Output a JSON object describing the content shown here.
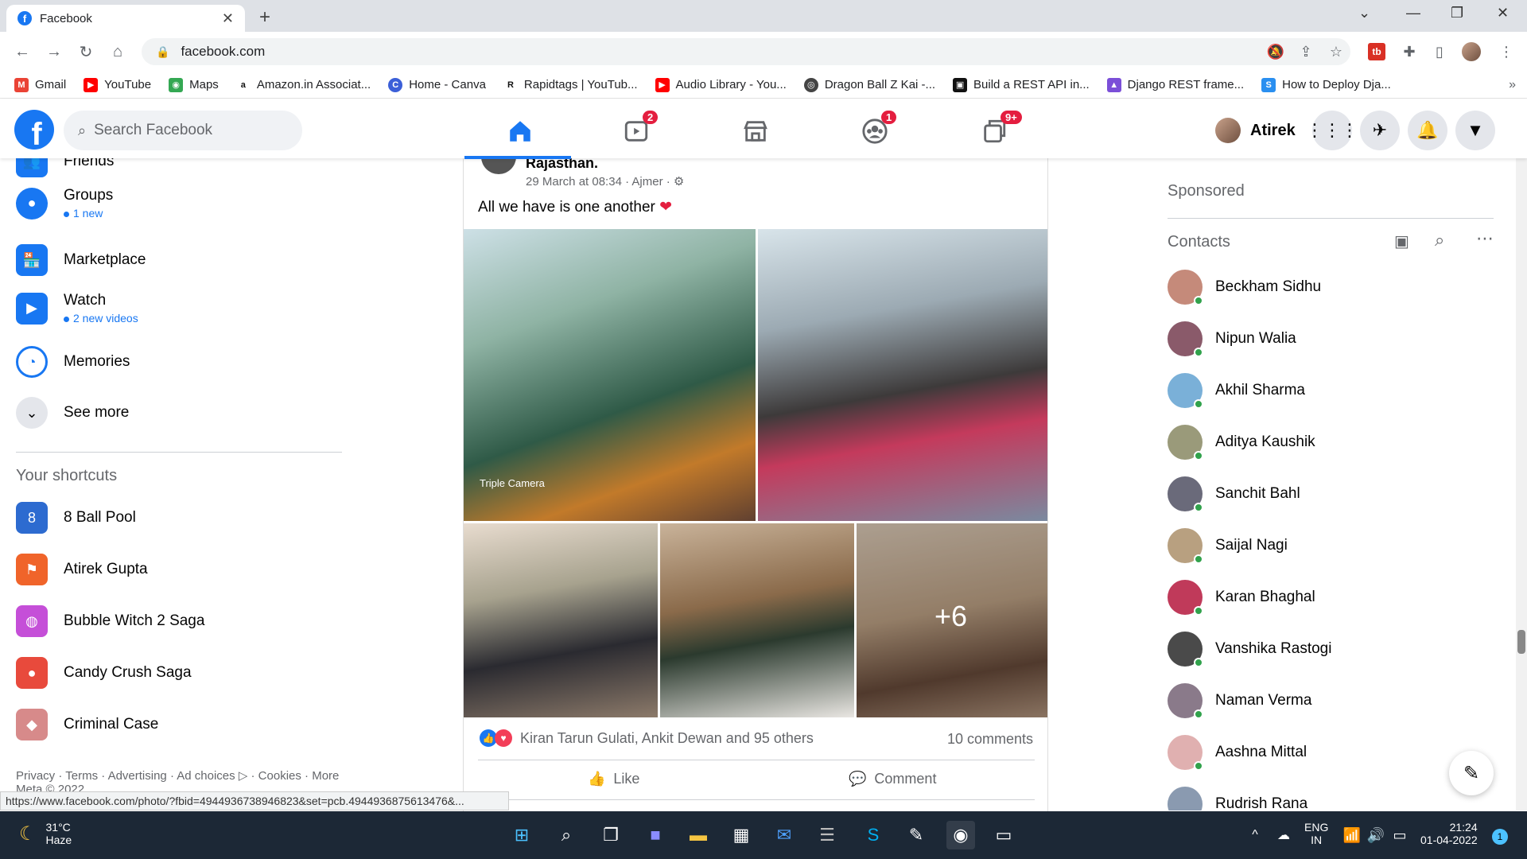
{
  "browser": {
    "tab_title": "Facebook",
    "url": "facebook.com",
    "bookmarks": [
      {
        "label": "Gmail",
        "icon": "gmail-icon",
        "color": "#ea4335"
      },
      {
        "label": "YouTube",
        "icon": "youtube-icon",
        "color": "#ff0000"
      },
      {
        "label": "Maps",
        "icon": "maps-icon",
        "color": "#34a853"
      },
      {
        "label": "Amazon.in Associat...",
        "icon": "amazon-icon",
        "color": "#111111"
      },
      {
        "label": "Home - Canva",
        "icon": "canva-icon",
        "color": "#3b5fd8"
      },
      {
        "label": "Rapidtags | YouTub...",
        "icon": "rapidtags-icon",
        "color": "#111111"
      },
      {
        "label": "Audio Library - You...",
        "icon": "youtube-icon",
        "color": "#ff0000"
      },
      {
        "label": "Dragon Ball Z Kai -...",
        "icon": "site-icon",
        "color": "#444444"
      },
      {
        "label": "Build a REST API in...",
        "icon": "site-icon",
        "color": "#111111"
      },
      {
        "label": "Django REST frame...",
        "icon": "site-icon",
        "color": "#7b4fd8"
      },
      {
        "label": "How to Deploy Dja...",
        "icon": "site-icon",
        "color": "#2a8ff0"
      }
    ],
    "status_url": "https://www.facebook.com/photo/?fbid=4944936738946823&set=pcb.4944936875613476&..."
  },
  "fb_header": {
    "search_placeholder": "Search Facebook",
    "badges": {
      "watch": "2",
      "groups": "1",
      "gaming": "9+"
    },
    "profile_name": "Atirek"
  },
  "left_nav": {
    "partial_top": "Friends",
    "items": [
      {
        "label": "Groups",
        "sub": "1 new"
      },
      {
        "label": "Marketplace",
        "sub": ""
      },
      {
        "label": "Watch",
        "sub": "2 new videos"
      },
      {
        "label": "Memories",
        "sub": ""
      },
      {
        "label": "See more",
        "sub": ""
      }
    ],
    "shortcuts_title": "Your shortcuts",
    "shortcuts": [
      "8 Ball Pool",
      "Atirek Gupta",
      "Bubble Witch 2 Saga",
      "Candy Crush Saga",
      "Criminal Case"
    ],
    "footer": "Privacy · Terms · Advertising · Ad choices ▷ · Cookies · More",
    "footer2": "Meta © 2022"
  },
  "post": {
    "author_partial": "Rajasthan.",
    "meta": "29 March at 08:34 · Ajmer ·",
    "text": "All we have is one another",
    "photo_overlay": "Triple Camera",
    "more_photos": "+6",
    "reactions": "Kiran Tarun Gulati, Ankit Dewan and 95 others",
    "comments": "10 comments",
    "like_label": "Like",
    "comment_label": "Comment"
  },
  "right_col": {
    "sponsored": "Sponsored",
    "contacts_title": "Contacts",
    "contacts": [
      "Beckham Sidhu",
      "Nipun Walia",
      "Akhil Sharma",
      "Aditya Kaushik",
      "Sanchit Bahl",
      "Saijal Nagi",
      "Karan Bhaghal",
      "Vanshika Rastogi",
      "Naman Verma",
      "Aashna Mittal",
      "Rudrish Rana"
    ]
  },
  "taskbar": {
    "weather_temp": "31°C",
    "weather_desc": "Haze",
    "lang1": "ENG",
    "lang2": "IN",
    "time": "21:24",
    "date": "01-04-2022",
    "notif_count": "1"
  }
}
